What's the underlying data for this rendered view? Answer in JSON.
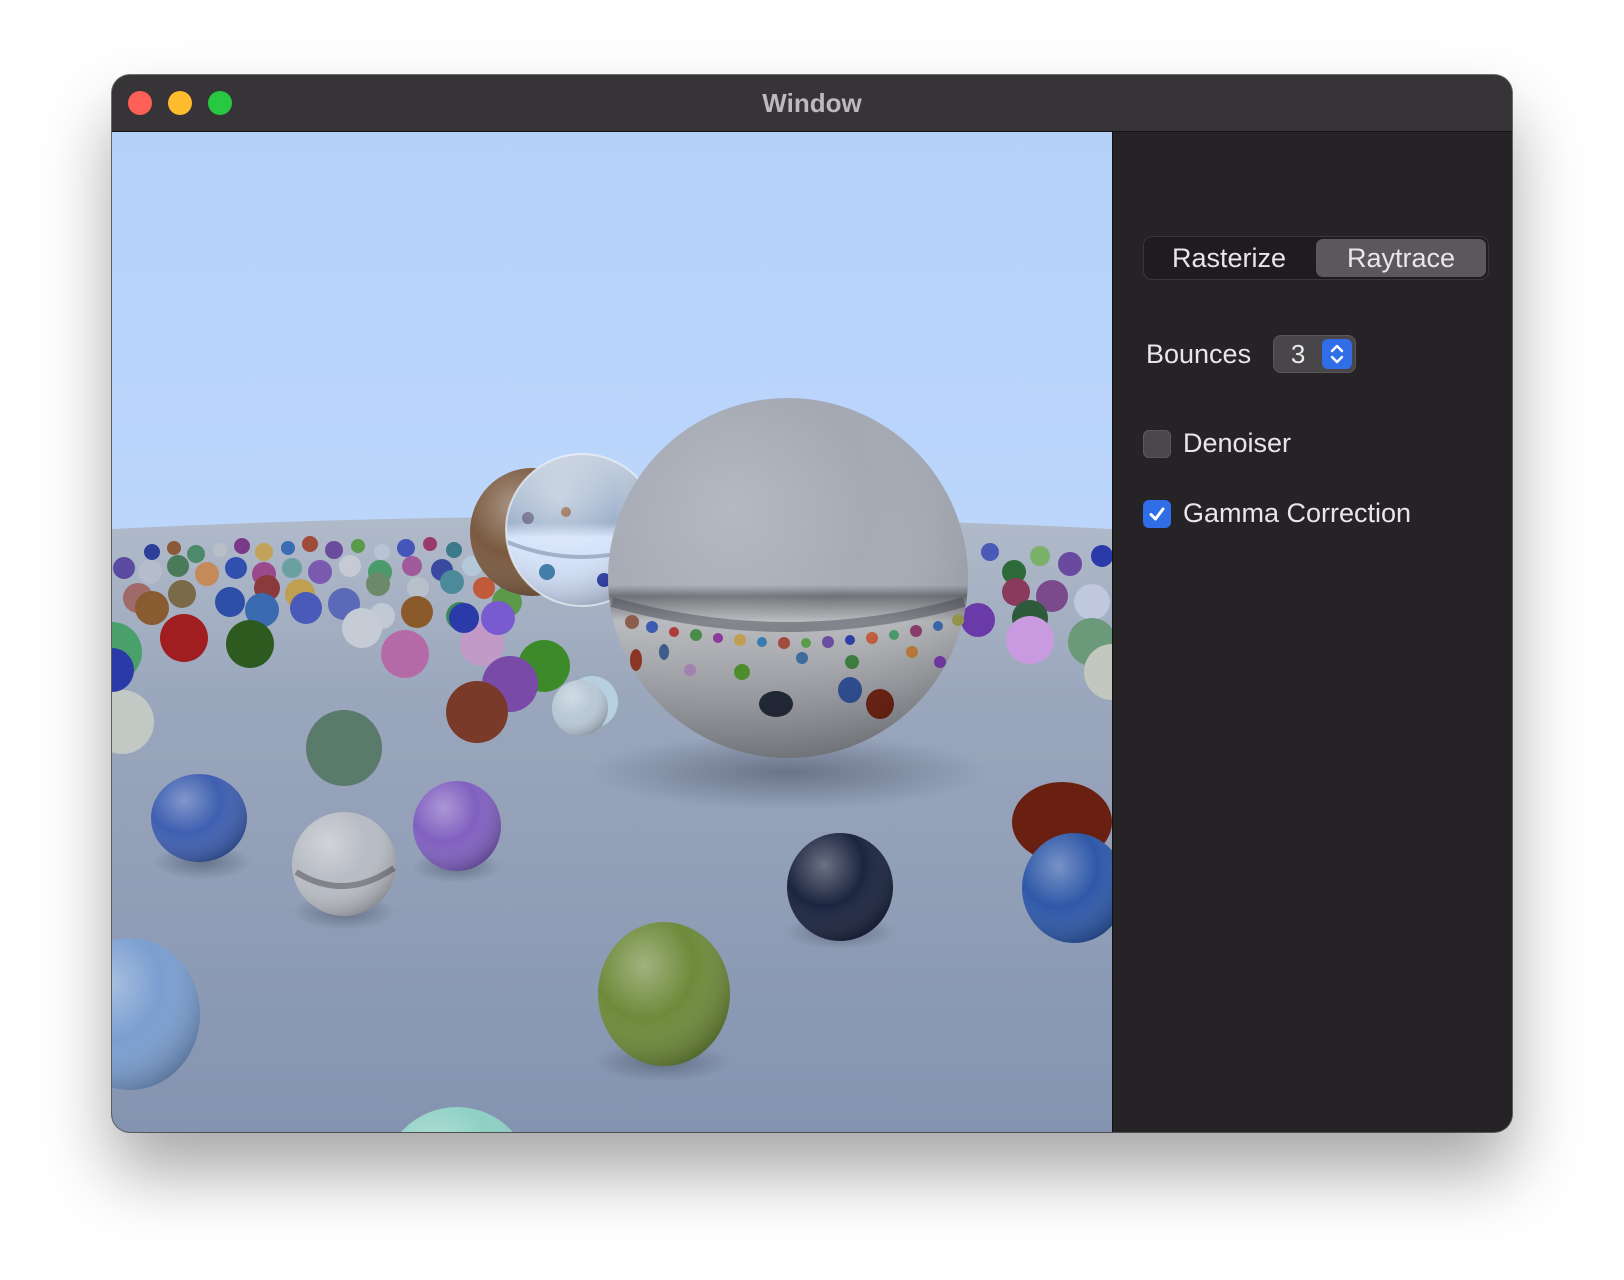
{
  "window": {
    "title": "Window"
  },
  "render_modes": {
    "options": [
      "Rasterize",
      "Raytrace"
    ],
    "selected": "Raytrace"
  },
  "bounces": {
    "label": "Bounces",
    "value": "3"
  },
  "denoiser": {
    "label": "Denoiser",
    "checked": false
  },
  "gamma_correction": {
    "label": "Gamma Correction",
    "checked": true
  },
  "colors": {
    "sky": "#b7d3fb",
    "ground": "#8e9bb2",
    "accent": "#2f6ee6"
  },
  "icons": {
    "stepper": "chevron-up-down-icon",
    "check": "checkmark-icon"
  }
}
